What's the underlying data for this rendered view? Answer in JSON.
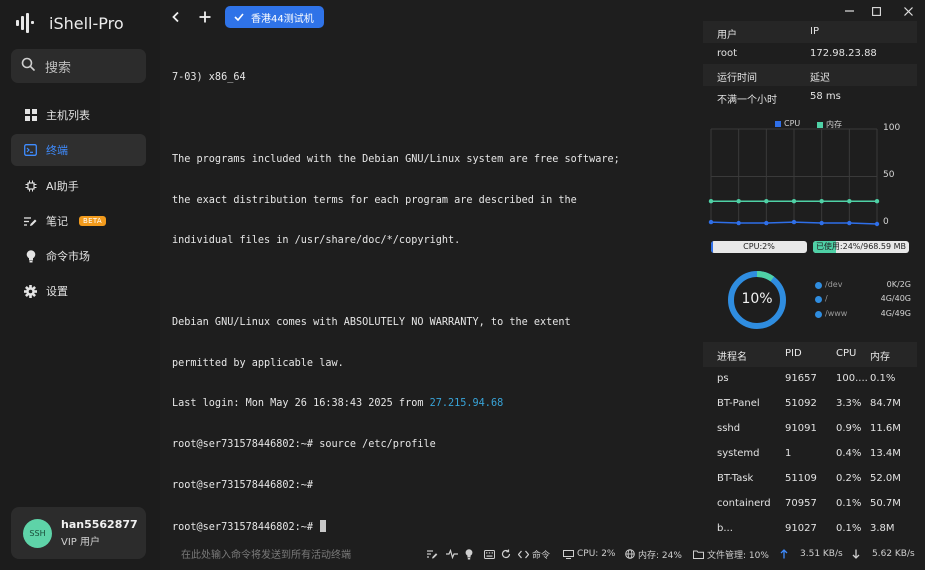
{
  "app": {
    "name": "iShell-Pro"
  },
  "sidebar": {
    "search_label": "搜索",
    "items": [
      {
        "label": "主机列表",
        "icon": "grid-icon"
      },
      {
        "label": "终端",
        "icon": "terminal-icon"
      },
      {
        "label": "AI助手",
        "icon": "ai-icon"
      },
      {
        "label": "笔记",
        "icon": "note-icon",
        "badge": "BETA"
      },
      {
        "label": "命令市场",
        "icon": "bulb-icon"
      },
      {
        "label": "设置",
        "icon": "gear-icon"
      }
    ],
    "user": {
      "avatar_text": "SSH",
      "name": "han5562877",
      "tier": "VIP 用户"
    }
  },
  "topbar": {
    "tab_label": "香港44测试机"
  },
  "terminal": {
    "lines": [
      "7-03) x86_64",
      "",
      "The programs included with the Debian GNU/Linux system are free software;",
      "the exact distribution terms for each program are described in the",
      "individual files in /usr/share/doc/*/copyright.",
      "",
      "Debian GNU/Linux comes with ABSOLUTELY NO WARRANTY, to the extent",
      "permitted by applicable law."
    ],
    "last_login_prefix": "Last login: Mon May 26 16:38:43 2025 from ",
    "last_login_ip": "27.215.94.68",
    "prompts": [
      "root@ser731578446802:~# source /etc/profile",
      "root@ser731578446802:~#",
      "root@ser731578446802:~#"
    ]
  },
  "statusbar": {
    "input_placeholder": "在此处输入命令将发送到所有活动终端",
    "command_label": "命令",
    "cpu": "CPU: 2%",
    "mem": "内存: 24%",
    "files": "文件管理: 10%",
    "upload": "3.51 KB/s",
    "download": "5.62 KB/s"
  },
  "monitor": {
    "info_headers": {
      "user": "用户",
      "ip": "IP",
      "uptime": "运行时间",
      "latency": "延迟"
    },
    "info_values": {
      "user": "root",
      "ip": "172.98.23.88",
      "uptime": "不满一个小时",
      "latency": "58 ms"
    },
    "cpu_bar_label": "CPU:2%",
    "mem_bar_label": "已使用:24%/968.59 MB",
    "cpu_percent": 2,
    "mem_percent": 24,
    "gauge_label": "10%",
    "gauge_percent": 10,
    "disks": [
      {
        "name": "/dev",
        "value": "0K/2G"
      },
      {
        "name": "/",
        "value": "4G/40G"
      },
      {
        "name": "/www",
        "value": "4G/49G"
      }
    ],
    "process_headers": [
      "进程名",
      "PID",
      "CPU",
      "内存"
    ],
    "processes": [
      [
        "ps",
        "91657",
        "100....",
        "0.1%"
      ],
      [
        "BT-Panel",
        "51092",
        "3.3%",
        "84.7M"
      ],
      [
        "sshd",
        "91091",
        "0.9%",
        "11.6M"
      ],
      [
        "systemd",
        "1",
        "0.4%",
        "13.4M"
      ],
      [
        "BT-Task",
        "51109",
        "0.2%",
        "52.0M"
      ],
      [
        "containerd",
        "70957",
        "0.1%",
        "50.7M"
      ],
      [
        "b...",
        "91027",
        "0.1%",
        "3.8M"
      ]
    ],
    "colors": {
      "cpu": "#2f6fe8",
      "mem": "#4fd1a6",
      "gauge": "#2f8de0"
    }
  },
  "chart_data": {
    "type": "line",
    "series": [
      {
        "name": "CPU",
        "values": [
          2,
          1,
          1,
          2,
          1,
          1,
          0
        ]
      },
      {
        "name": "内存",
        "values": [
          24,
          24,
          24,
          24,
          24,
          24,
          24
        ]
      }
    ],
    "ylim": [
      0,
      100
    ],
    "yticks": [
      "100",
      "50",
      "0"
    ],
    "grid": true,
    "legend": "top"
  }
}
